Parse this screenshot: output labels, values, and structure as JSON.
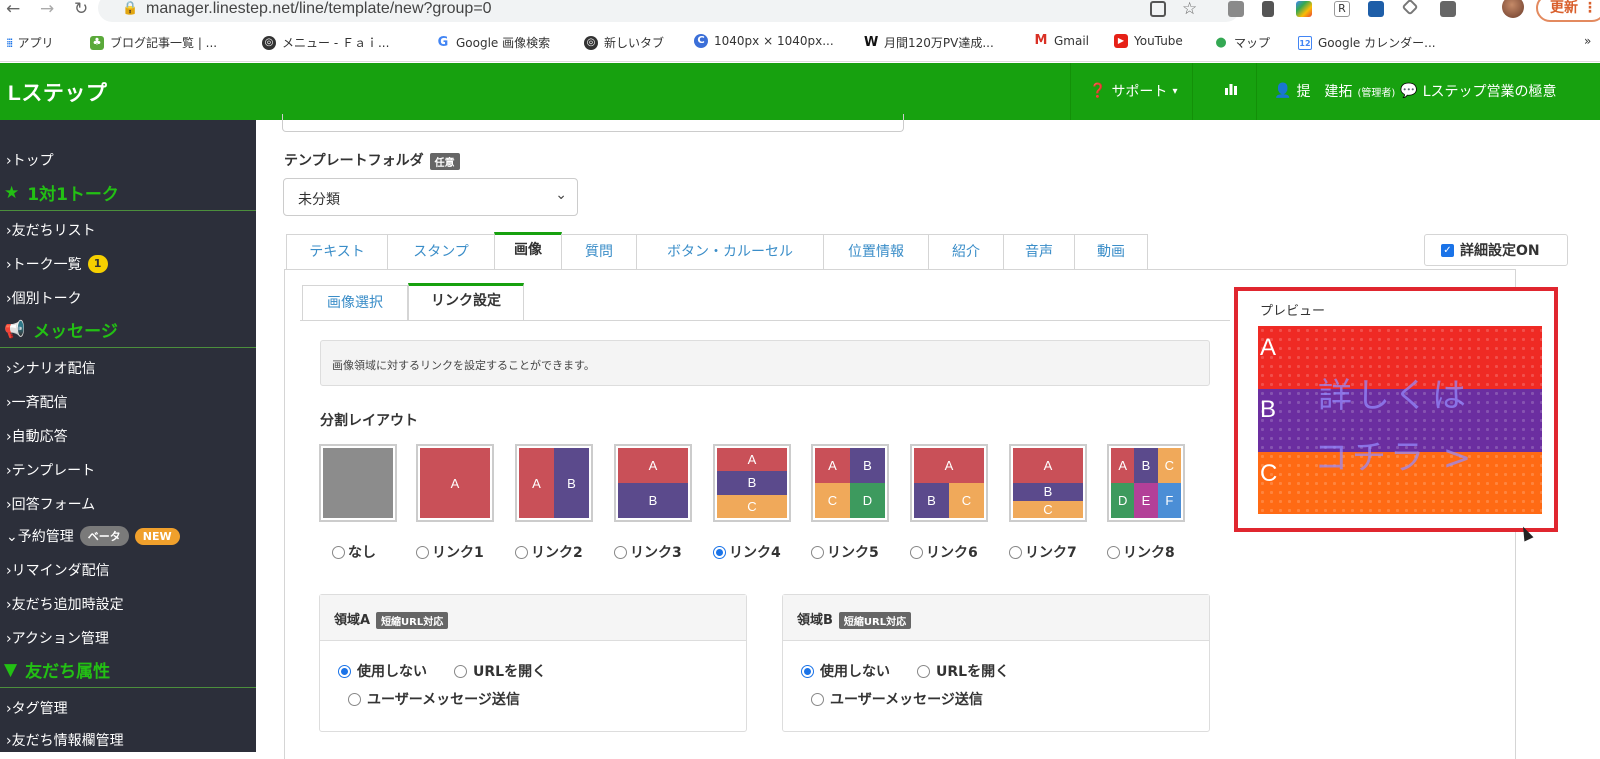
{
  "browser": {
    "url": "manager.linestep.net/line/template/new?group=0",
    "update_label": "更新",
    "bookmarks": [
      {
        "label": "アプリ"
      },
      {
        "label": "ブログ記事一覧 | ..."
      },
      {
        "label": "メニュー - Ｆａｉ..."
      },
      {
        "label": "Google 画像検索"
      },
      {
        "label": "新しいタブ"
      },
      {
        "label": "1040px × 1040px..."
      },
      {
        "label": "月間120万PV達成..."
      },
      {
        "label": "Gmail"
      },
      {
        "label": "YouTube"
      },
      {
        "label": "マップ"
      },
      {
        "label": "Google カレンダー..."
      }
    ],
    "more": "»"
  },
  "header": {
    "brand": "Lステップ",
    "support": "サポート",
    "user": "提　建拓",
    "user_role": "(管理者)",
    "account": "Lステップ営業の極意"
  },
  "sidebar": {
    "items": [
      {
        "label": "›トップ"
      },
      {
        "label": "1対1トーク",
        "section": true
      },
      {
        "label": "›友だちリスト"
      },
      {
        "label": "›トーク一覧",
        "badge": "1"
      },
      {
        "label": "›個別トーク"
      },
      {
        "label": "メッセージ",
        "section": true
      },
      {
        "label": "›シナリオ配信"
      },
      {
        "label": "›一斉配信"
      },
      {
        "label": "›自動応答"
      },
      {
        "label": "›テンプレート"
      },
      {
        "label": "›回答フォーム"
      },
      {
        "label": "⌄予約管理",
        "pill1": "ベータ",
        "pill2": "NEW"
      },
      {
        "label": "›リマインダ配信"
      },
      {
        "label": "›友だち追加時設定"
      },
      {
        "label": "›アクション管理"
      },
      {
        "label": "友だち属性",
        "section": true
      },
      {
        "label": "›タグ管理"
      },
      {
        "label": "›友だち情報欄管理"
      }
    ]
  },
  "form": {
    "folder_label": "テンプレートフォルダ",
    "folder_tag": "任意",
    "folder_value": "未分類",
    "tabs": [
      "テキスト",
      "スタンプ",
      "画像",
      "質問",
      "ボタン・カルーセル",
      "位置情報",
      "紹介",
      "音声",
      "動画"
    ],
    "active_tab": "画像",
    "detail_label": "詳細設定ON",
    "subtabs": [
      "画像選択",
      "リンク設定"
    ],
    "info_text": "画像領域に対するリンクを設定することができます。",
    "layout_label": "分割レイアウト",
    "layouts": [
      "なし",
      "リンク1",
      "リンク2",
      "リンク3",
      "リンク4",
      "リンク5",
      "リンク6",
      "リンク7",
      "リンク8"
    ],
    "selected_layout": "リンク4",
    "regions": [
      {
        "title": "領域A",
        "tag": "短縮URL対応",
        "opt1": "使用しない",
        "opt2": "URLを開く",
        "opt3": "ユーザーメッセージ送信"
      },
      {
        "title": "領域B",
        "tag": "短縮URL対応",
        "opt1": "使用しない",
        "opt2": "URLを開く",
        "opt3": "ユーザーメッセージ送信"
      }
    ]
  },
  "preview": {
    "title": "プレビュー",
    "labels": [
      "A",
      "B",
      "C"
    ],
    "overlay_line1": "詳しくは",
    "overlay_line2": "コチラ >"
  },
  "colors": {
    "brand_green": "#17a10f",
    "sidebar_bg": "#2c2f3a",
    "cell_a": "#c95058",
    "cell_b": "#5b4a8c",
    "cell_c": "#f0a95a",
    "cell_d": "#3d9a5e",
    "cell_e": "#b34098",
    "cell_f": "#4b8ed6",
    "highlight": "#e0262f"
  }
}
